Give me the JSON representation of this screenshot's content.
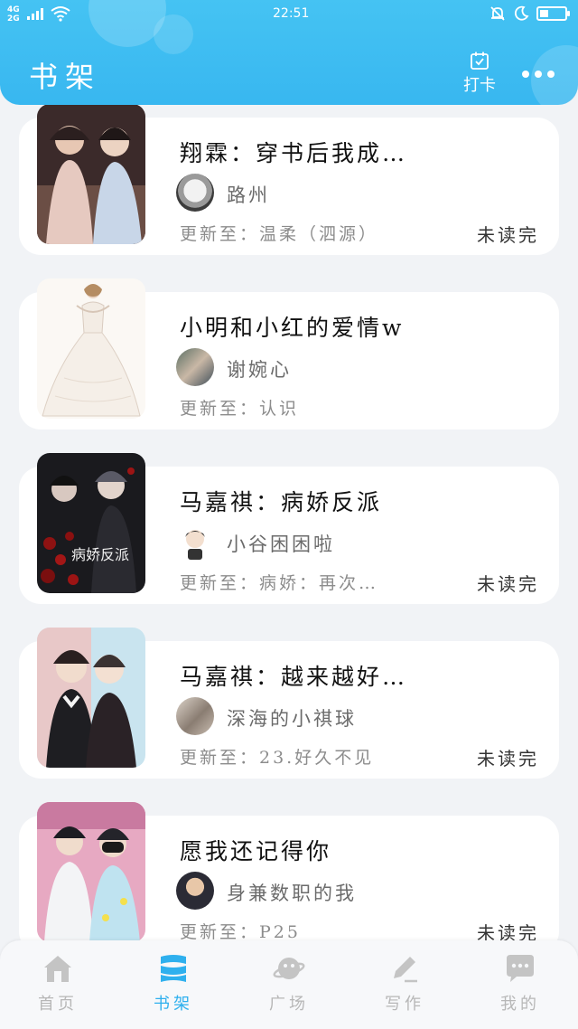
{
  "status_bar": {
    "network": "4G 2G",
    "time": "22:51",
    "battery_level": 0.35
  },
  "header": {
    "title": "书架",
    "checkin_label": "打卡"
  },
  "books": [
    {
      "title": "翔霖：穿书后我成…",
      "author": "路州",
      "update": "更新至：温柔（泗源）",
      "status": "未读完"
    },
    {
      "title": "小明和小红的爱情w",
      "author": "谢婉心",
      "update": "更新至：认识",
      "status": ""
    },
    {
      "title": "马嘉祺：病娇反派",
      "author": "小谷困困啦",
      "update": "更新至：病娇：再次…",
      "status": "未读完",
      "cover_text": "病娇反派"
    },
    {
      "title": "马嘉祺：越来越好…",
      "author": "深海的小祺球",
      "update": "更新至：23.好久不见",
      "status": "未读完"
    },
    {
      "title": "愿我还记得你",
      "author": "身兼数职的我",
      "update": "更新至：P25",
      "status": "未读完"
    }
  ],
  "nav": [
    {
      "label": "首页",
      "icon": "home-icon"
    },
    {
      "label": "书架",
      "icon": "bookshelf-icon",
      "active": true
    },
    {
      "label": "广场",
      "icon": "planet-icon"
    },
    {
      "label": "写作",
      "icon": "pen-icon"
    },
    {
      "label": "我的",
      "icon": "chat-bubble-icon"
    }
  ],
  "colors": {
    "accent": "#38b7f0",
    "background": "#f1f3f6"
  }
}
